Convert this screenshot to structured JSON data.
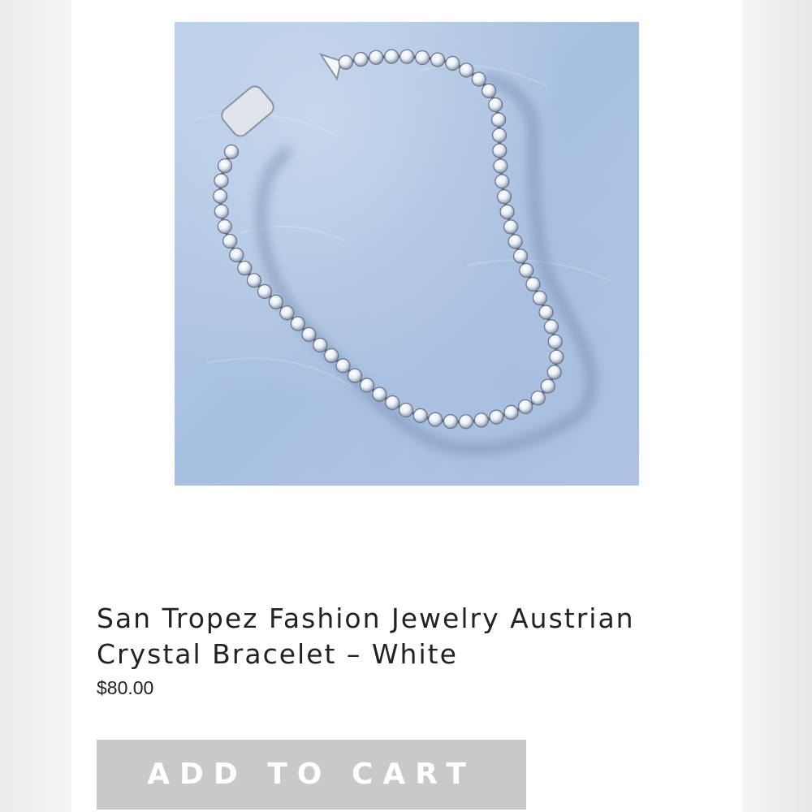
{
  "product": {
    "image_alt": "Crystal tennis bracelet on light blue textured background",
    "title": "San Tropez Fashion Jewelry Austrian Crystal Bracelet – White",
    "price": "$80.00",
    "add_to_cart_label": "ADD TO CART"
  },
  "colors": {
    "image_background": "#b3c8e6",
    "button_background": "#c9c9c9",
    "button_text": "#ffffff",
    "title_text": "#222222"
  }
}
